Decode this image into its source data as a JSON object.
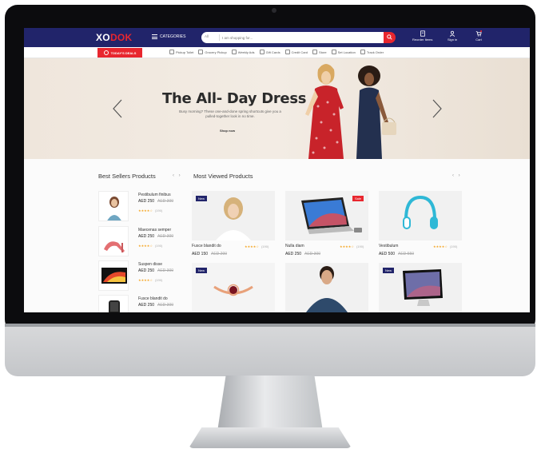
{
  "header": {
    "logo_main": "XO",
    "logo_accent": "DOK",
    "categories_label": "CATEGORIES",
    "search_scope": "All",
    "search_placeholder": "I am shopping for...",
    "reorder_label": "Reorder Items",
    "signin_label": "Sign in",
    "cart_label": "Cart",
    "cart_count": "0"
  },
  "subnav": {
    "deals_label": "TODAY'S DEALS",
    "links": [
      "Pickup Toilet",
      "Grocery Pickup",
      "Weekly Ads",
      "Gift Cards",
      "Credit Card",
      "Store",
      "Set Location",
      "Track Order"
    ]
  },
  "hero": {
    "title": "The All- Day Dress",
    "subtitle": "Busy morning? These one-and-done spring shortcuts give you a pulled-together look in no time.",
    "cta": "Shop now"
  },
  "best_sellers": {
    "title": "Best Sellers Products",
    "items": [
      {
        "name": "Pestibulum finibus",
        "price": "AED 250",
        "old_price": "AED 300",
        "stars": "★★★★☆",
        "reviews": "(190)"
      },
      {
        "name": "Maecenas semper",
        "price": "AED 250",
        "old_price": "AED 300",
        "stars": "★★★★☆",
        "reviews": "(190)"
      },
      {
        "name": "Suspen disse",
        "price": "AED 250",
        "old_price": "AED 300",
        "stars": "★★★★☆",
        "reviews": "(190)"
      },
      {
        "name": "Fusce blandit do",
        "price": "AED 250",
        "old_price": "AED 300",
        "stars": "★★★★☆",
        "reviews": "(190)"
      }
    ]
  },
  "most_viewed": {
    "title": "Most Viewed Products",
    "cards": [
      {
        "badge": "New",
        "name": "Fusce blandit do",
        "price": "AED 150",
        "old_price": "AED 200",
        "stars": "★★★★☆",
        "reviews": "(190)"
      },
      {
        "badge": "Sale",
        "name": "Nulla diam",
        "price": "AED 250",
        "old_price": "AED 300",
        "stars": "★★★★☆",
        "reviews": "(190)"
      },
      {
        "badge": "",
        "name": "Vestibulum",
        "price": "AED 500",
        "old_price": "AED 550",
        "stars": "★★★★☆",
        "reviews": "(190)"
      },
      {
        "badge": "New"
      },
      {
        "badge": ""
      },
      {
        "badge": "New"
      }
    ]
  },
  "colors": {
    "brand_navy": "#21246a",
    "brand_red": "#e8262e"
  }
}
